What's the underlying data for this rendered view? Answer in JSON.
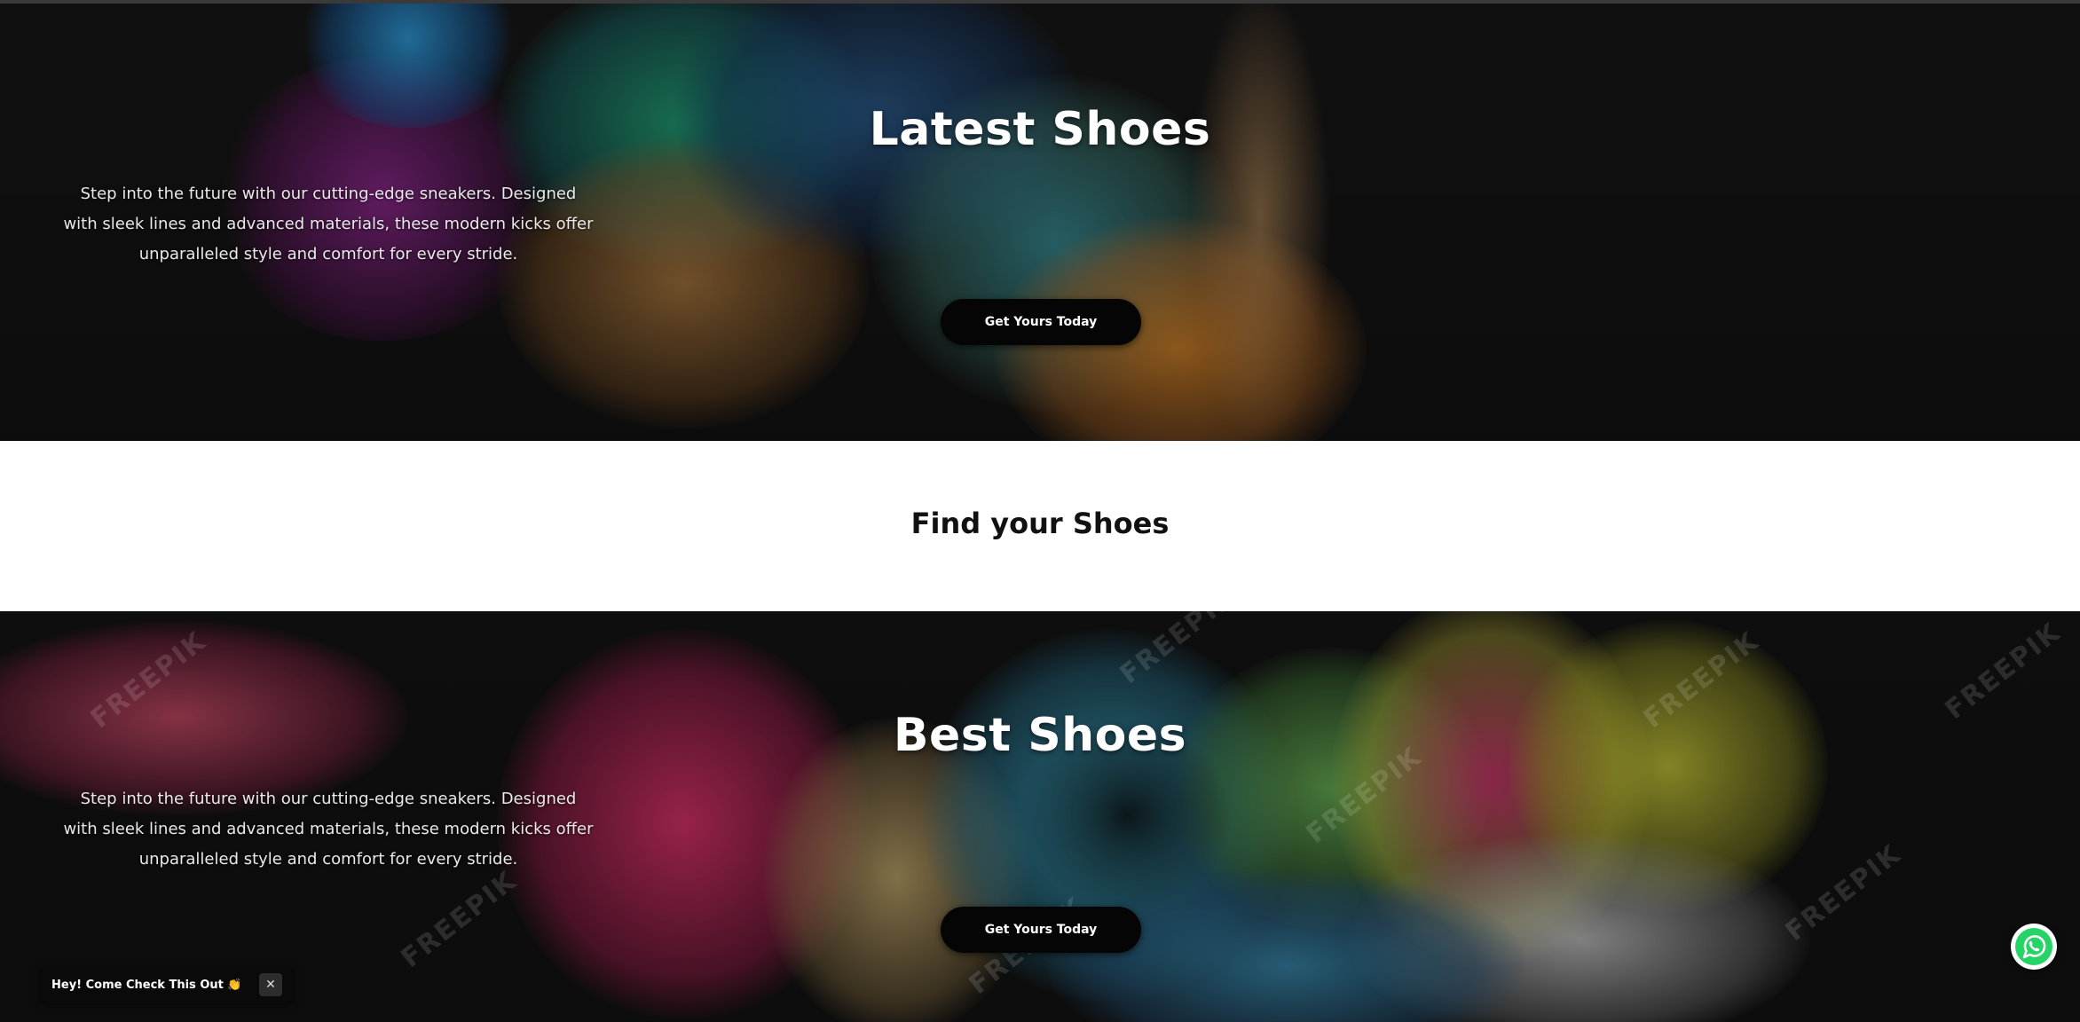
{
  "hero_latest": {
    "title": "Latest Shoes",
    "description": "Step into the future with our cutting-edge sneakers. Designed with sleek lines and advanced materials, these modern kicks offer unparalleled style and comfort for every stride.",
    "cta_label": "Get Yours Today"
  },
  "find_section": {
    "title": "Find your Shoes"
  },
  "hero_best": {
    "title": "Best Shoes",
    "description": "Step into the future with our cutting-edge sneakers. Designed with sleek lines and advanced materials, these modern kicks offer unparalleled style and comfort for every stride.",
    "cta_label": "Get Yours Today",
    "watermark": "FREEPIK"
  },
  "chat_toast": {
    "message": "Hey! Come Check This Out 👏",
    "close_icon": "close-icon"
  },
  "whatsapp": {
    "icon": "whatsapp-icon"
  },
  "colors": {
    "whatsapp_green": "#25D366",
    "cta_background": "#050505"
  }
}
